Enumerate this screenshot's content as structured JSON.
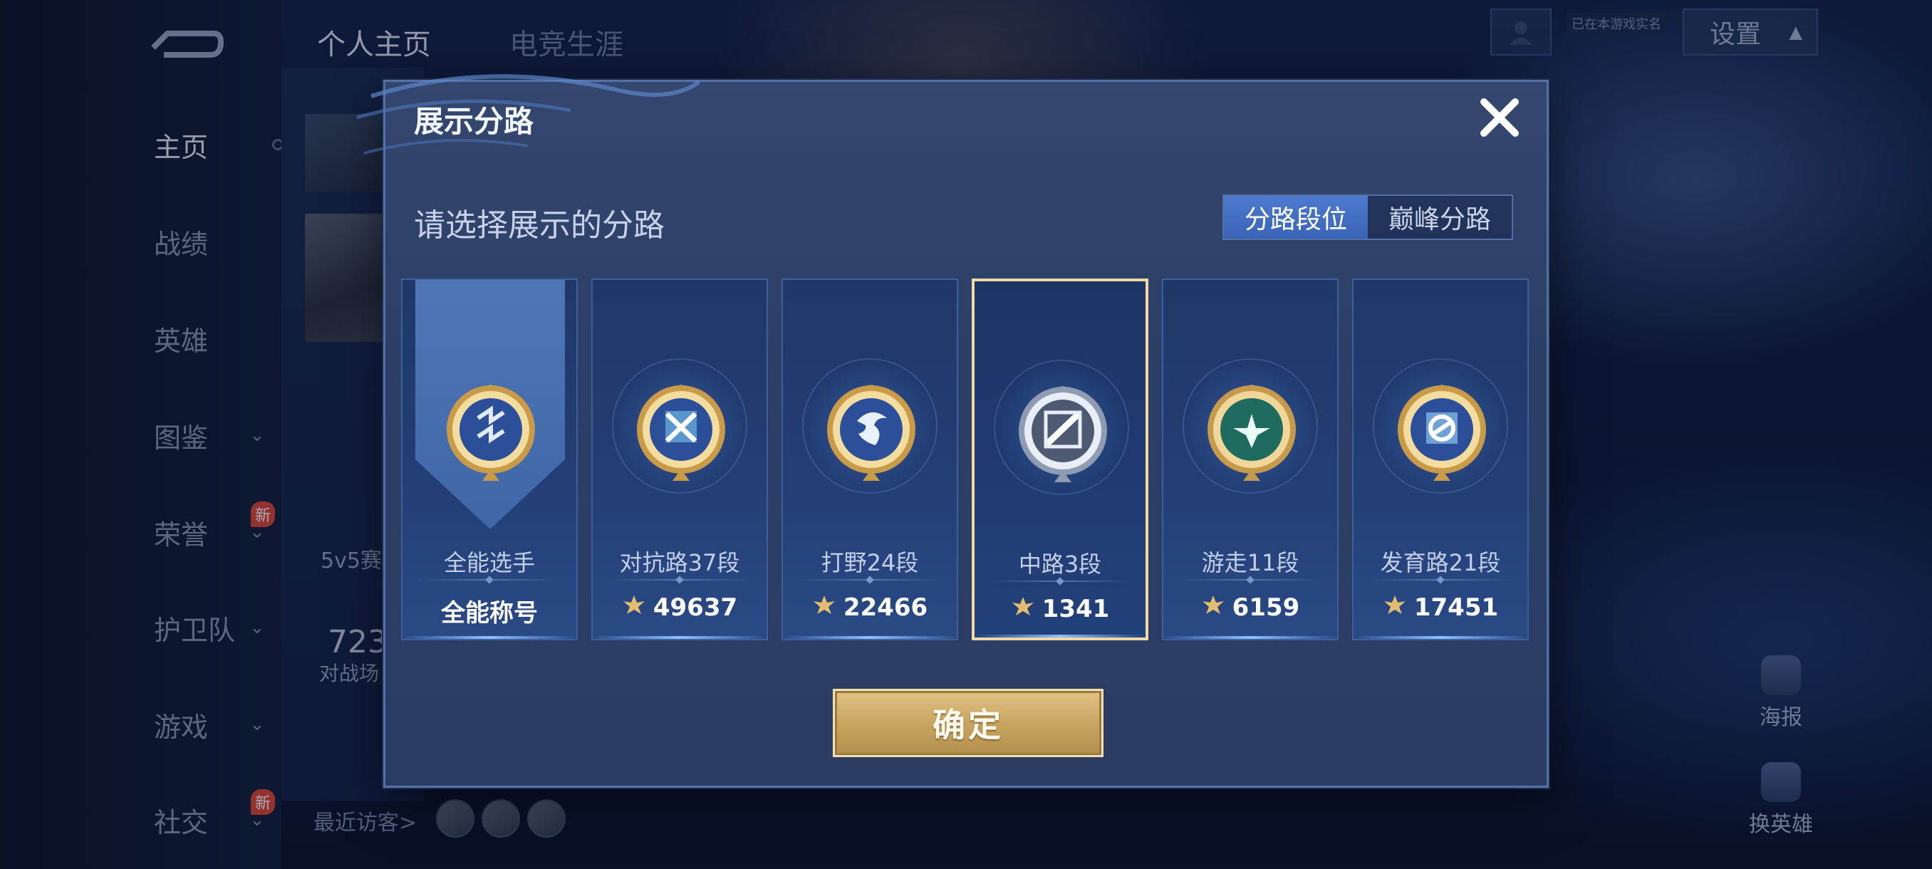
{
  "background": {
    "top_tabs": [
      "个人主页",
      "电竞生涯"
    ],
    "sidebar": [
      {
        "label": "主页",
        "active": true,
        "chevron": false,
        "is_new": false
      },
      {
        "label": "战绩",
        "active": false,
        "chevron": false,
        "is_new": false
      },
      {
        "label": "英雄",
        "active": false,
        "chevron": false,
        "is_new": false
      },
      {
        "label": "图鉴",
        "active": false,
        "chevron": true,
        "is_new": false
      },
      {
        "label": "荣誉",
        "active": false,
        "chevron": true,
        "is_new": true
      },
      {
        "label": "护卫队",
        "active": false,
        "chevron": true,
        "is_new": false
      },
      {
        "label": "游戏",
        "active": false,
        "chevron": true,
        "is_new": false
      },
      {
        "label": "社交",
        "active": false,
        "chevron": true,
        "is_new": true
      }
    ],
    "new_badge": "新",
    "settings_label": "设置",
    "status_tag": "已在本游戏实名",
    "mode_text": "5v5赛",
    "stat_number": "723",
    "stat_label": "对战场",
    "recent_visitors": "最近访客>",
    "right_buttons": [
      "海报",
      "换英雄"
    ]
  },
  "modal": {
    "title": "展示分路",
    "subtitle": "请选择展示的分路",
    "tabs": [
      {
        "label": "分路段位",
        "active": true
      },
      {
        "label": "巅峰分路",
        "active": false
      }
    ],
    "cards": [
      {
        "title": "全能选手",
        "value": "全能称号",
        "show_icon": false,
        "medal": "all-round",
        "selected": false,
        "ribbon": true
      },
      {
        "title": "对抗路37段",
        "value": "49637",
        "show_icon": true,
        "medal": "clash-lane",
        "selected": false,
        "ribbon": false
      },
      {
        "title": "打野24段",
        "value": "22466",
        "show_icon": true,
        "medal": "jungle",
        "selected": false,
        "ribbon": false
      },
      {
        "title": "中路3段",
        "value": "1341",
        "show_icon": true,
        "medal": "mid-lane",
        "selected": true,
        "ribbon": false
      },
      {
        "title": "游走11段",
        "value": "6159",
        "show_icon": true,
        "medal": "roam",
        "selected": false,
        "ribbon": false
      },
      {
        "title": "发育路21段",
        "value": "17451",
        "show_icon": true,
        "medal": "farm-lane",
        "selected": false,
        "ribbon": false
      }
    ],
    "confirm_label": "确定"
  },
  "colors": {
    "accent_blue": "#3a64b6",
    "gold": "#c9a561",
    "selected_border": "#f1d9a6"
  }
}
